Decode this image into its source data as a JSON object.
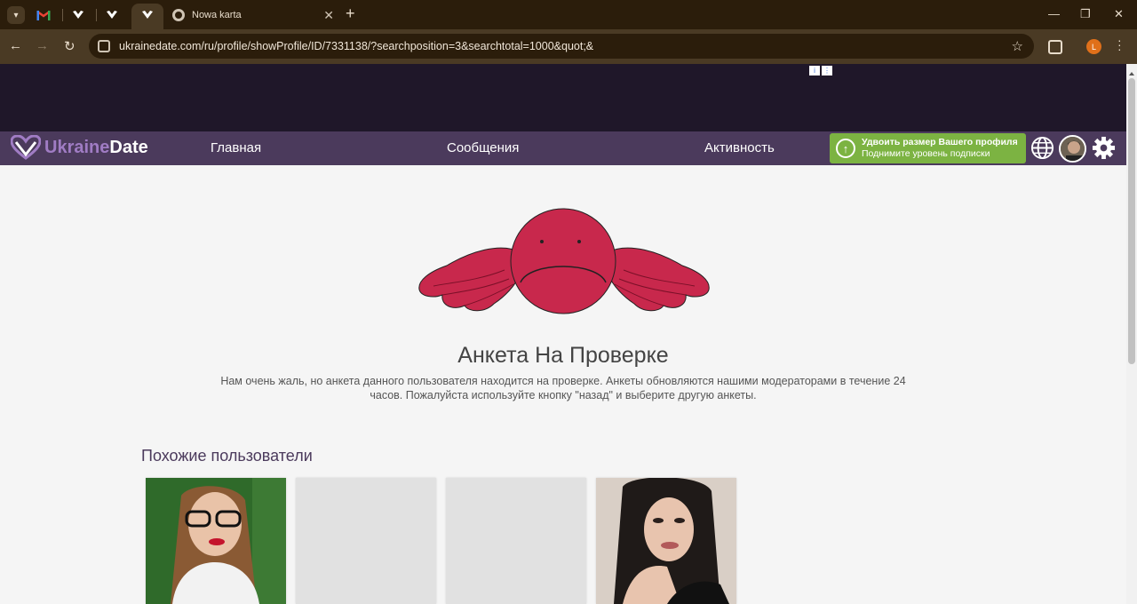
{
  "browser": {
    "tabs": [
      {
        "icon": "gmail-icon"
      },
      {
        "icon": "ukrainedate-icon"
      },
      {
        "icon": "ukrainedate-icon"
      },
      {
        "icon": "ukrainedate-icon",
        "active": true
      },
      {
        "icon": "chrome-icon",
        "label": "Nowa karta"
      }
    ],
    "url": "ukrainedate.com/ru/profile/showProfile/ID/7331138/?searchposition=3&searchtotal=1000&quot;&",
    "profile_initial": "L"
  },
  "site": {
    "logo_part1": "Ukraine",
    "logo_part2": "Date",
    "menu": [
      "Главная",
      "Сообщения",
      "Активность"
    ],
    "upgrade_line1": "Удвоить размер Вашего профиля",
    "upgrade_line2": "Поднимите уровень подписки"
  },
  "main": {
    "title": "Анкета На Проверке",
    "message": "Нам очень жаль, но анкета данного пользователя находится на проверке. Анкеты обновляются нашими модераторами в течение 24 часов. Пожалуйста используйте кнопку \"назад\" и выберите другую анкеты.",
    "similar_heading": "Похожие пользователи",
    "similar_cards": [
      {
        "photo": true
      },
      {
        "photo": false
      },
      {
        "photo": false
      },
      {
        "photo": true
      }
    ]
  },
  "colors": {
    "tabbar": "#2b1d0b",
    "toolbar": "#4a3a24",
    "site_nav": "#4b3a5c",
    "upgrade": "#7cb342",
    "mascot": "#c8284c"
  }
}
